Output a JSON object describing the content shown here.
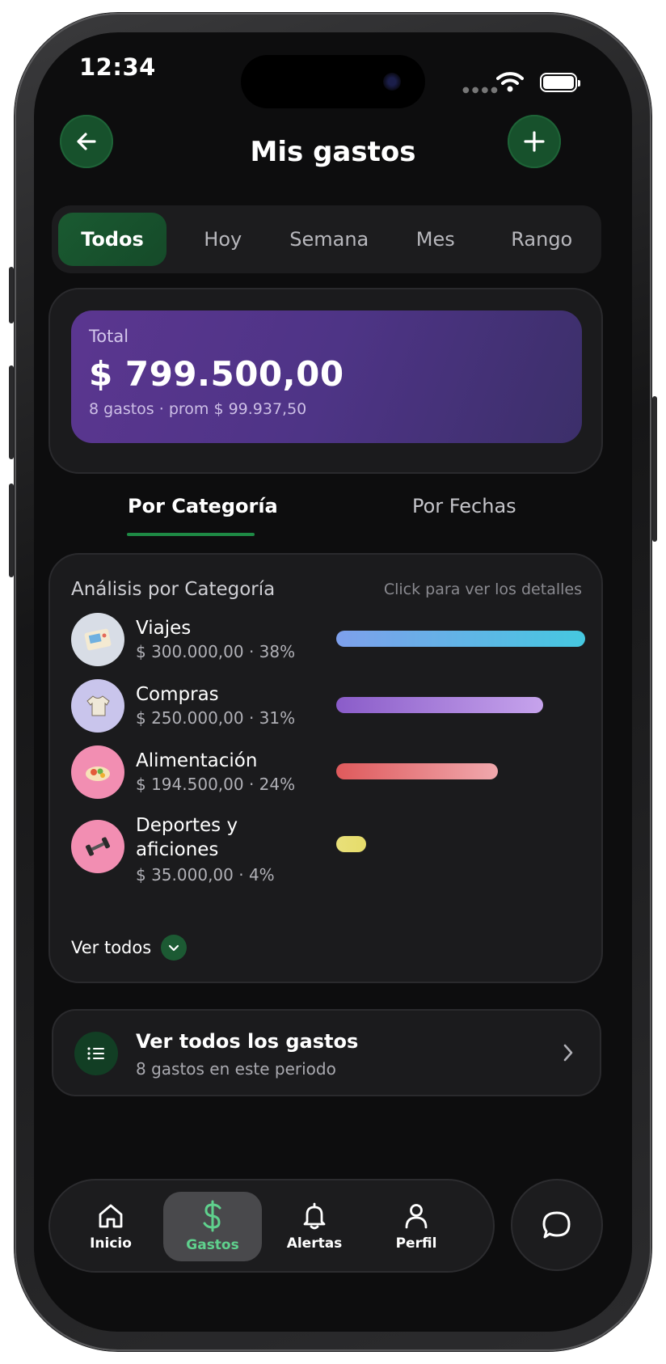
{
  "status_bar": {
    "time": "12:34"
  },
  "header": {
    "title": "Mis gastos"
  },
  "filters": [
    "Todos",
    "Hoy",
    "Semana",
    "Mes",
    "Rango"
  ],
  "total": {
    "label": "Total",
    "value": "$ 799.500,00",
    "subtitle": "8 gastos · prom $ 99.937,50"
  },
  "view_tabs": {
    "active": "Por Categoría",
    "inactive": "Por Fechas"
  },
  "analysis": {
    "title": "Análisis por Categoría",
    "hint": "Click para ver los detalles",
    "categories": [
      {
        "name": "Viajes",
        "detail": "$ 300.000,00 · 38%",
        "icon": "travel-photo-icon",
        "share": 1.0,
        "bar_from": "#7ea0ec",
        "bar_to": "#45c8e0",
        "icon_bg": "#d8dde6"
      },
      {
        "name": "Compras",
        "detail": "$ 250.000,00 · 31%",
        "icon": "shirt-icon",
        "share": 0.83,
        "bar_from": "#8a5cc9",
        "bar_to": "#c6a3ec",
        "icon_bg": "#c9c5ec"
      },
      {
        "name": "Alimentación",
        "detail": "$ 194.500,00 · 24%",
        "icon": "food-bowl-icon",
        "share": 0.65,
        "bar_from": "#df5a5c",
        "bar_to": "#f0a8ad",
        "icon_bg": "#f28eb2"
      },
      {
        "name": "Deportes y aficiones",
        "detail": "$ 35.000,00 · 4%",
        "icon": "dumbbell-icon",
        "share": 0.12,
        "bar_from": "#e8e07a",
        "bar_to": "#e6dc6a",
        "icon_bg": "#f28eb2"
      }
    ],
    "see_all": "Ver todos"
  },
  "all_expenses": {
    "title": "Ver todos los gastos",
    "subtitle": "8 gastos en este periodo"
  },
  "nav": [
    {
      "label": "Inicio",
      "icon": "home-icon"
    },
    {
      "label": "Gastos",
      "icon": "dollar-icon"
    },
    {
      "label": "Alertas",
      "icon": "bell-icon"
    },
    {
      "label": "Perfil",
      "icon": "user-icon"
    }
  ],
  "colors": {
    "accent": "#1e8a45",
    "accent_text": "#5fd18d",
    "background": "#0d0d0e"
  }
}
